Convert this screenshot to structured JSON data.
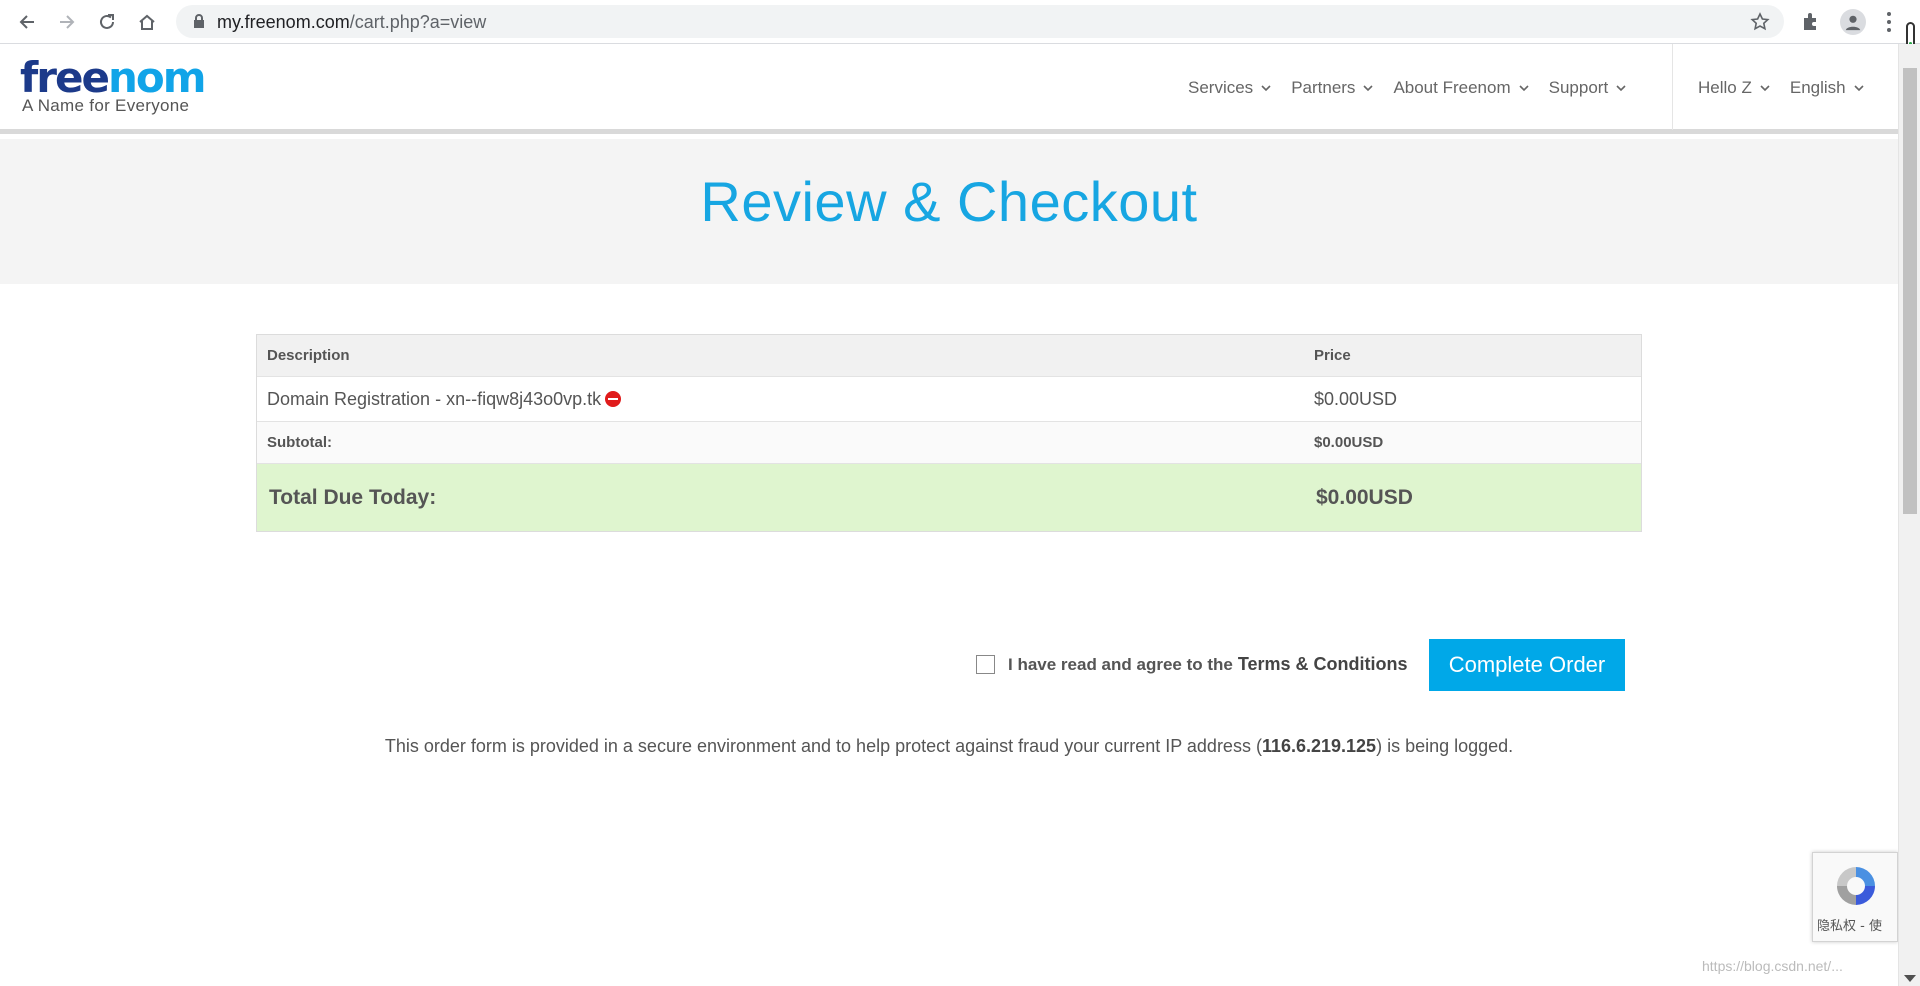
{
  "browser": {
    "url_host": "my.freenom.com",
    "url_path": "/cart.php?a=view"
  },
  "header": {
    "logo_free": "free",
    "logo_nom": "nom",
    "tagline": "A Name for Everyone",
    "nav": [
      "Services",
      "Partners",
      "About Freenom",
      "Support"
    ],
    "user_greeting": "Hello Z",
    "language": "English"
  },
  "page": {
    "title": "Review & Checkout"
  },
  "cart": {
    "headers": {
      "description": "Description",
      "price": "Price"
    },
    "item": {
      "description": "Domain Registration - xn--fiqw8j43o0vp.tk",
      "price": "$0.00USD"
    },
    "subtotal": {
      "label": "Subtotal:",
      "value": "$0.00USD"
    },
    "total": {
      "label": "Total Due Today:",
      "value": "$0.00USD"
    }
  },
  "agreement": {
    "text": "I have read and agree to the",
    "link": "Terms & Conditions",
    "checked": false
  },
  "complete_button": "Complete Order",
  "secure_note": {
    "before": "This order form is provided in a secure environment and to help protect against fraud your current IP address (",
    "ip": "116.6.219.125",
    "after": ") is being logged."
  },
  "recaptcha": {
    "privacy": "隐私权 - 使"
  },
  "watermark": "https://blog.csdn.net/...",
  "colors": {
    "brand_blue": "#17a6e2",
    "button_blue": "#00a8e8",
    "total_bg": "#dff5cf"
  }
}
